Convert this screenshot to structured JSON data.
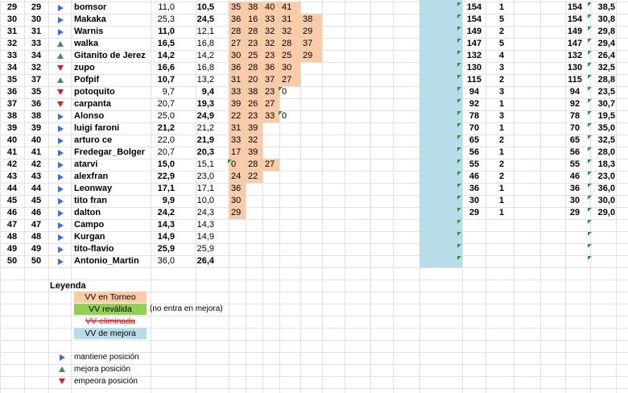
{
  "rows": [
    {
      "a": "29",
      "b": "29",
      "mv": "same",
      "name": "bomsor",
      "v1": "11,0",
      "v2": "10,5",
      "v2b": true,
      "t": [
        "35",
        "38",
        "40",
        "41",
        ""
      ],
      "p1": "154",
      "p2": "1",
      "p3": "154",
      "p4": "38,5"
    },
    {
      "a": "30",
      "b": "30",
      "mv": "same",
      "name": "Makaka",
      "v1": "25,3",
      "v2": "24,5",
      "v2b": true,
      "t": [
        "36",
        "16",
        "33",
        "31",
        "38"
      ],
      "p1": "154",
      "p2": "5",
      "p3": "154",
      "p4": "30,8"
    },
    {
      "a": "31",
      "b": "31",
      "mv": "same",
      "name": "Warnis",
      "v1": "11,0",
      "v2": "12,1",
      "v1b": true,
      "t": [
        "28",
        "28",
        "32",
        "32",
        "29"
      ],
      "p1": "149",
      "p2": "2",
      "p3": "149",
      "p4": "29,8"
    },
    {
      "a": "32",
      "b": "33",
      "mv": "up",
      "name": "walka",
      "v1": "16,5",
      "v2": "16,8",
      "v1b": true,
      "t": [
        "27",
        "23",
        "32",
        "28",
        "37"
      ],
      "p1": "147",
      "p2": "5",
      "p3": "147",
      "p4": "29,4"
    },
    {
      "a": "33",
      "b": "34",
      "mv": "up",
      "name": "Gitanito de Jerez",
      "v1": "14,2",
      "v2": "14,2",
      "v1b": true,
      "t": [
        "30",
        "25",
        "23",
        "25",
        "29"
      ],
      "p1": "132",
      "p2": "4",
      "p3": "132",
      "p4": "26,4"
    },
    {
      "a": "34",
      "b": "32",
      "mv": "down",
      "name": "zupo",
      "v1": "16,6",
      "v2": "16,8",
      "v1b": true,
      "t": [
        "36",
        "28",
        "36",
        "30",
        ""
      ],
      "p1": "130",
      "p2": "3",
      "p3": "130",
      "p4": "32,5"
    },
    {
      "a": "35",
      "b": "37",
      "mv": "up",
      "name": "Pofpif",
      "v1": "10,7",
      "v2": "13,2",
      "v1b": true,
      "t": [
        "31",
        "20",
        "37",
        "27",
        ""
      ],
      "p1": "115",
      "p2": "2",
      "p3": "115",
      "p4": "28,8"
    },
    {
      "a": "36",
      "b": "35",
      "mv": "down",
      "name": "potoquito",
      "v1": "9,7",
      "v2": "9,4",
      "v2b": true,
      "t": [
        "33",
        "38",
        "23",
        "0",
        ""
      ],
      "p1": "94",
      "p2": "3",
      "p3": "94",
      "p4": "23,5"
    },
    {
      "a": "37",
      "b": "36",
      "mv": "down",
      "name": "carpanta",
      "v1": "20,7",
      "v2": "19,3",
      "v2b": true,
      "t": [
        "39",
        "26",
        "27",
        "",
        ""
      ],
      "p1": "92",
      "p2": "1",
      "p3": "92",
      "p4": "30,7"
    },
    {
      "a": "38",
      "b": "38",
      "mv": "same",
      "name": "Alonso",
      "v1": "25,0",
      "v2": "24,9",
      "v2b": true,
      "t": [
        "22",
        "23",
        "33",
        "0",
        ""
      ],
      "p1": "78",
      "p2": "3",
      "p3": "78",
      "p4": "19,5"
    },
    {
      "a": "39",
      "b": "39",
      "mv": "same",
      "name": "luigi faroni",
      "v1": "21,2",
      "v2": "21,2",
      "v1b": true,
      "t": [
        "31",
        "39",
        "",
        "",
        ""
      ],
      "p1": "70",
      "p2": "1",
      "p3": "70",
      "p4": "35,0"
    },
    {
      "a": "40",
      "b": "40",
      "mv": "same",
      "name": "arturo ce",
      "v1": "22,0",
      "v2": "21,9",
      "v2b": true,
      "t": [
        "33",
        "32",
        "",
        "",
        ""
      ],
      "p1": "65",
      "p2": "2",
      "p3": "65",
      "p4": "32,5"
    },
    {
      "a": "41",
      "b": "41",
      "mv": "same",
      "name": "Fredegar_Bolger",
      "v1": "20,7",
      "v2": "20,3",
      "v2b": true,
      "t": [
        "17",
        "39",
        "",
        "",
        ""
      ],
      "p1": "56",
      "p2": "1",
      "p3": "56",
      "p4": "28,0"
    },
    {
      "a": "42",
      "b": "42",
      "mv": "same",
      "name": "atarvi",
      "v1": "15,0",
      "v2": "15,1",
      "v1b": true,
      "t": [
        "0",
        "28",
        "27",
        "",
        ""
      ],
      "p1": "55",
      "p2": "2",
      "p3": "55",
      "p4": "18,3"
    },
    {
      "a": "43",
      "b": "43",
      "mv": "same",
      "name": "alexfran",
      "v1": "22,9",
      "v2": "23,0",
      "v1b": true,
      "t": [
        "24",
        "22",
        "",
        "",
        ""
      ],
      "p1": "46",
      "p2": "2",
      "p3": "46",
      "p4": "23,0"
    },
    {
      "a": "44",
      "b": "44",
      "mv": "same",
      "name": "Leonway",
      "v1": "17,1",
      "v2": "17,1",
      "v1b": true,
      "t": [
        "36",
        "",
        "",
        "",
        ""
      ],
      "p1": "36",
      "p2": "1",
      "p3": "36",
      "p4": "36,0"
    },
    {
      "a": "45",
      "b": "45",
      "mv": "same",
      "name": "tito fran",
      "v1": "9,9",
      "v2": "10,0",
      "v1b": true,
      "t": [
        "30",
        "",
        "",
        "",
        ""
      ],
      "p1": "30",
      "p2": "1",
      "p3": "30",
      "p4": "30,0"
    },
    {
      "a": "46",
      "b": "46",
      "mv": "same",
      "name": "dalton",
      "v1": "24,2",
      "v2": "24,3",
      "v1b": true,
      "t": [
        "29",
        "",
        "",
        "",
        ""
      ],
      "p1": "29",
      "p2": "1",
      "p3": "29",
      "p4": "29,0"
    },
    {
      "a": "47",
      "b": "47",
      "mv": "same",
      "name": "Campo",
      "v1": "14,3",
      "v2": "14,3",
      "v1b": true,
      "t": [
        "",
        "",
        "",
        "",
        ""
      ],
      "p1": "",
      "p2": "",
      "p3": "",
      "p4": ""
    },
    {
      "a": "48",
      "b": "48",
      "mv": "same",
      "name": "Kurgan",
      "v1": "14,9",
      "v2": "14,9",
      "v1b": true,
      "t": [
        "",
        "",
        "",
        "",
        ""
      ],
      "p1": "",
      "p2": "",
      "p3": "",
      "p4": ""
    },
    {
      "a": "49",
      "b": "49",
      "mv": "same",
      "name": "tito-flavio",
      "v1": "25,9",
      "v2": "25,9",
      "v1b": true,
      "t": [
        "",
        "",
        "",
        "",
        ""
      ],
      "p1": "",
      "p2": "",
      "p3": "",
      "p4": ""
    },
    {
      "a": "50",
      "b": "50",
      "mv": "same",
      "name": "Antonio_Martin",
      "v1": "36,0",
      "v2": "26,4",
      "v2b": true,
      "t": [
        "",
        "",
        "",
        "",
        ""
      ],
      "p1": "",
      "p2": "",
      "p3": "",
      "p4": ""
    }
  ],
  "legend": {
    "title": "Leyenda",
    "torneo": "VV en Torneo",
    "revalida": "VV reválida",
    "revalida_note": "(no entra en mejora)",
    "eliminada": "VV eliminada",
    "mejora": "VV de mejora",
    "mantiene": "mantiene posición",
    "mejora_pos": "mejora posición",
    "empeora": "empeora posición"
  },
  "colors": {
    "torneo": "#f8cba9",
    "revalida": "#92d050",
    "mejora": "#b7dde8",
    "arrow_same": "#3b6fe0",
    "arrow_up": "#3e8f5f",
    "arrow_down": "#e01a1a",
    "eliminada_text": "#ff0000"
  }
}
